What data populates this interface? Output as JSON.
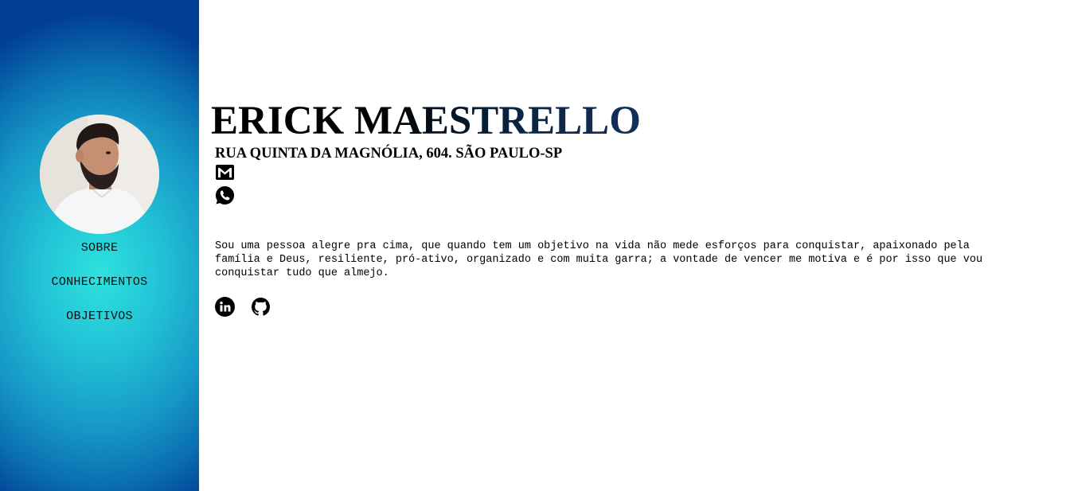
{
  "sidebar": {
    "avatar_alt": "Foto de perfil",
    "nav": [
      {
        "label": "SOBRE"
      },
      {
        "label": "CONHECIMENTOS"
      },
      {
        "label": "OBJETIVOS"
      }
    ]
  },
  "header": {
    "name": "ERICK MAESTRELLO",
    "address": "RUA QUINTA DA MAGNÓLIA, 604. SÃO PAULO-SP"
  },
  "contacts": {
    "email_icon": "gmail-icon",
    "phone_icon": "whatsapp-icon"
  },
  "about": {
    "text": "Sou uma pessoa alegre pra cima, que quando tem um objetivo na vida não mede esforços para conquistar, apaixonado pela família e Deus, resiliente, pró-ativo, organizado e com muita garra; a vontade de vencer me motiva e é por isso que vou conquistar tudo que almejo."
  },
  "social": {
    "linkedin_icon": "linkedin-icon",
    "github_icon": "github-icon"
  },
  "colors": {
    "sidebar_center": "#2ee2de",
    "sidebar_edge": "#023e93",
    "title_accent": "#12305a"
  }
}
